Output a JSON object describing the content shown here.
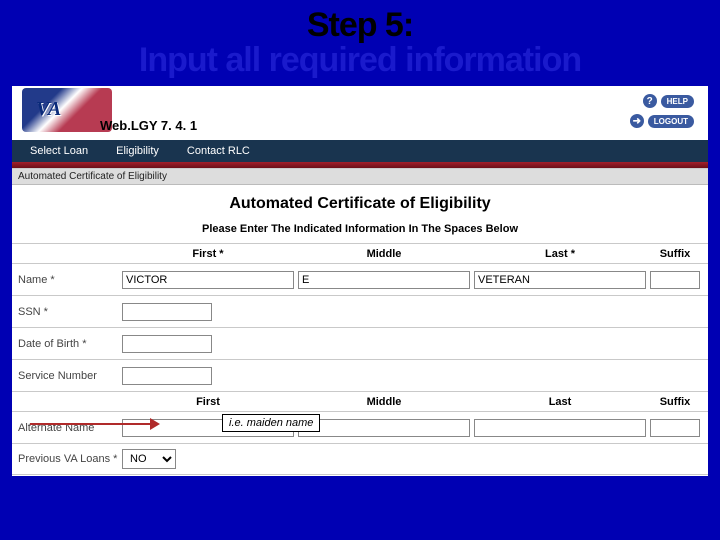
{
  "slide": {
    "step": "Step 5:",
    "subtitle": "Input all required information"
  },
  "app": {
    "title": "Web.LGY 7. 4. 1",
    "help": "HELP",
    "logout": "LOGOUT",
    "menu": {
      "select": "Select Loan",
      "elig": "Eligibility",
      "contact": "Contact RLC"
    },
    "breadcrumb": "Automated Certificate of Eligibility",
    "page_heading": "Automated Certificate of Eligibility",
    "prompt": "Please Enter The Indicated Information In The Spaces Below",
    "columns": {
      "first": "First *",
      "middle": "Middle",
      "last": "Last *",
      "suffix": "Suffix",
      "first2": "First",
      "last2": "Last"
    },
    "labels": {
      "name": "Name *",
      "ssn": "SSN *",
      "dob": "Date of Birth *",
      "service": "Service Number",
      "altname": "Alternate Name",
      "prev": "Previous VA Loans *"
    },
    "values": {
      "first": "VICTOR",
      "middle": "E",
      "last": "VETERAN",
      "suffix": "",
      "ssn": "",
      "dob": "",
      "service": "",
      "alt_first": "",
      "alt_middle": "",
      "alt_last": "",
      "alt_suffix": "",
      "prev": "NO"
    },
    "annotation": "i.e. maiden name"
  }
}
